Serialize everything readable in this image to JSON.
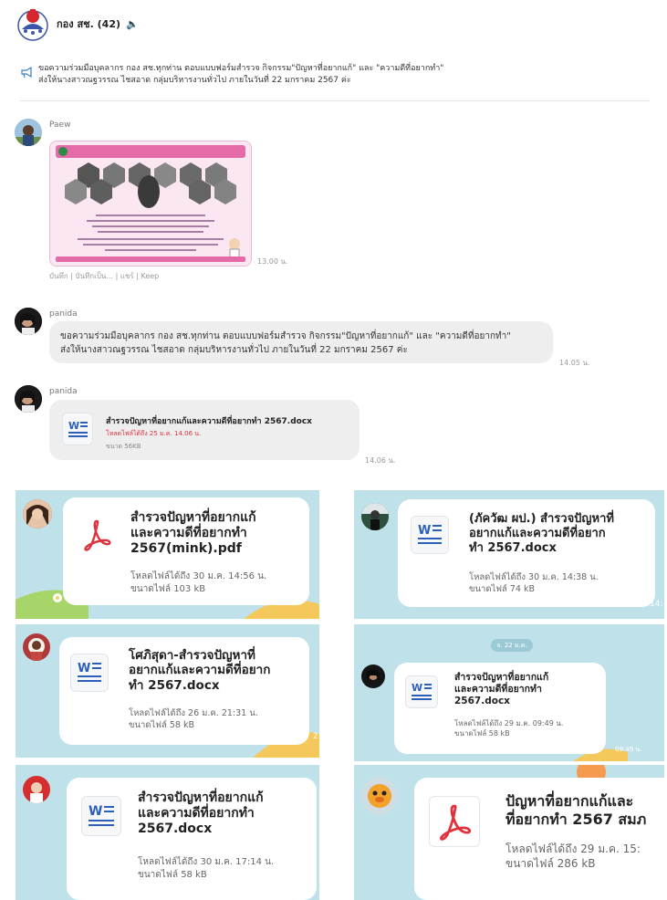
{
  "header": {
    "title": "กอง สช. (42)",
    "mute_icon": "speaker-icon"
  },
  "announcement": {
    "line1": "ขอความร่วมมือบุคลากร กอง สช.ทุกท่าน  ตอบแบบฟอร์มสำรวจ กิจกรรม\"ปัญหาที่อยากแก้\" และ \"ความดีที่อยากทำ\"",
    "line2": "ส่งให้นางสาวณฐวรรณ ไชสอาด กลุ่มบริหารงานทั่วไป ภายในวันที่ 22 มกราคม 2567 ค่ะ"
  },
  "messages": [
    {
      "sender": "Paew",
      "time": "13.00 น.",
      "actions": "บันทึก | บันทึกเป็น... | แชร์ | Keep"
    },
    {
      "sender": "panida",
      "line1": "ขอความร่วมมือบุคลากร กอง สช.ทุกท่าน  ตอบแบบฟอร์มสำรวจ กิจกรรม\"ปัญหาที่อยากแก้\" และ \"ความดีที่อยากทำ\"",
      "line2": "ส่งให้นางสาวณฐวรรณ ไชสอาด กลุ่มบริหารงานทั่วไป ภายในวันที่ 22 มกราคม 2567 ค่ะ",
      "time": "14.05 น."
    },
    {
      "sender": "panida",
      "file_name": "สำรวจปัญหาที่อยากแก้และความดีที่อยากทำ 2567.docx",
      "expiry": "โหลดไฟล์ได้ถึง 25 ม.ค. 14.06 น.",
      "size": "ขนาด 56KB",
      "time": "14.06 น."
    }
  ],
  "tiles": [
    {
      "l1": "สำรวจปัญหาที่อยากแก้",
      "l2": "และความดีที่อยากทำ",
      "l3": "2567(mink).pdf",
      "expiry": "โหลดไฟล์ได้ถึง 30 ม.ค. 14:56 น.",
      "size": "ขนาดไฟล์ 103 kB",
      "icon": "pdf-icon"
    },
    {
      "l1": "(ภัควัฒ ผป.) สำรวจปัญหาที่",
      "l2": "อยากแก้และความดีที่อยาก",
      "l3": "ทำ 2567.docx",
      "expiry": "โหลดไฟล์ได้ถึง 30 ม.ค. 14:38 น.",
      "size": "ขนาดไฟล์ 74 kB",
      "icon": "word-icon",
      "edge": "14:"
    },
    {
      "l1": "โศภิสุดา-สำรวจปัญหาที่",
      "l2": "อยากแก้และความดีที่อยาก",
      "l3": "ทำ 2567.docx",
      "expiry": "โหลดไฟล์ได้ถึง 26 ม.ค. 21:31 น.",
      "size": "ขนาดไฟล์ 58 kB",
      "icon": "word-icon",
      "edge": "2"
    },
    {
      "l1": "สำรวจปัญหาที่อยากแก้",
      "l2": "และความดีที่อยากทำ",
      "l3": "2567.docx",
      "expiry": "โหลดไฟล์ได้ถึง 29 ม.ค. 09:49 น.",
      "size": "ขนาดไฟล์ 58 kB",
      "icon": "word-icon",
      "date_chip": "จ. 22 ม.ค.",
      "time": "09:49 น."
    },
    {
      "l1": "สำรวจปัญหาที่อยากแก้",
      "l2": "และความดีที่อยากทำ",
      "l3": "2567.docx",
      "expiry": "โหลดไฟล์ได้ถึง 30 ม.ค. 17:14 น.",
      "size": "ขนาดไฟล์ 58 kB",
      "icon": "word-icon"
    },
    {
      "l1": "ปัญหาที่อยากแก้และ",
      "l2": "ที่อยากทำ 2567 สมภ",
      "expiry": "โหลดไฟล์ได้ถึง 29 ม.ค. 15:",
      "size": "ขนาดไฟล์ 286 kB",
      "icon": "pdf-icon"
    }
  ],
  "colors": {
    "expiry_red": "#e0323c",
    "tile_sky": "#bfe1ea",
    "bubble": "#eeeeee"
  }
}
